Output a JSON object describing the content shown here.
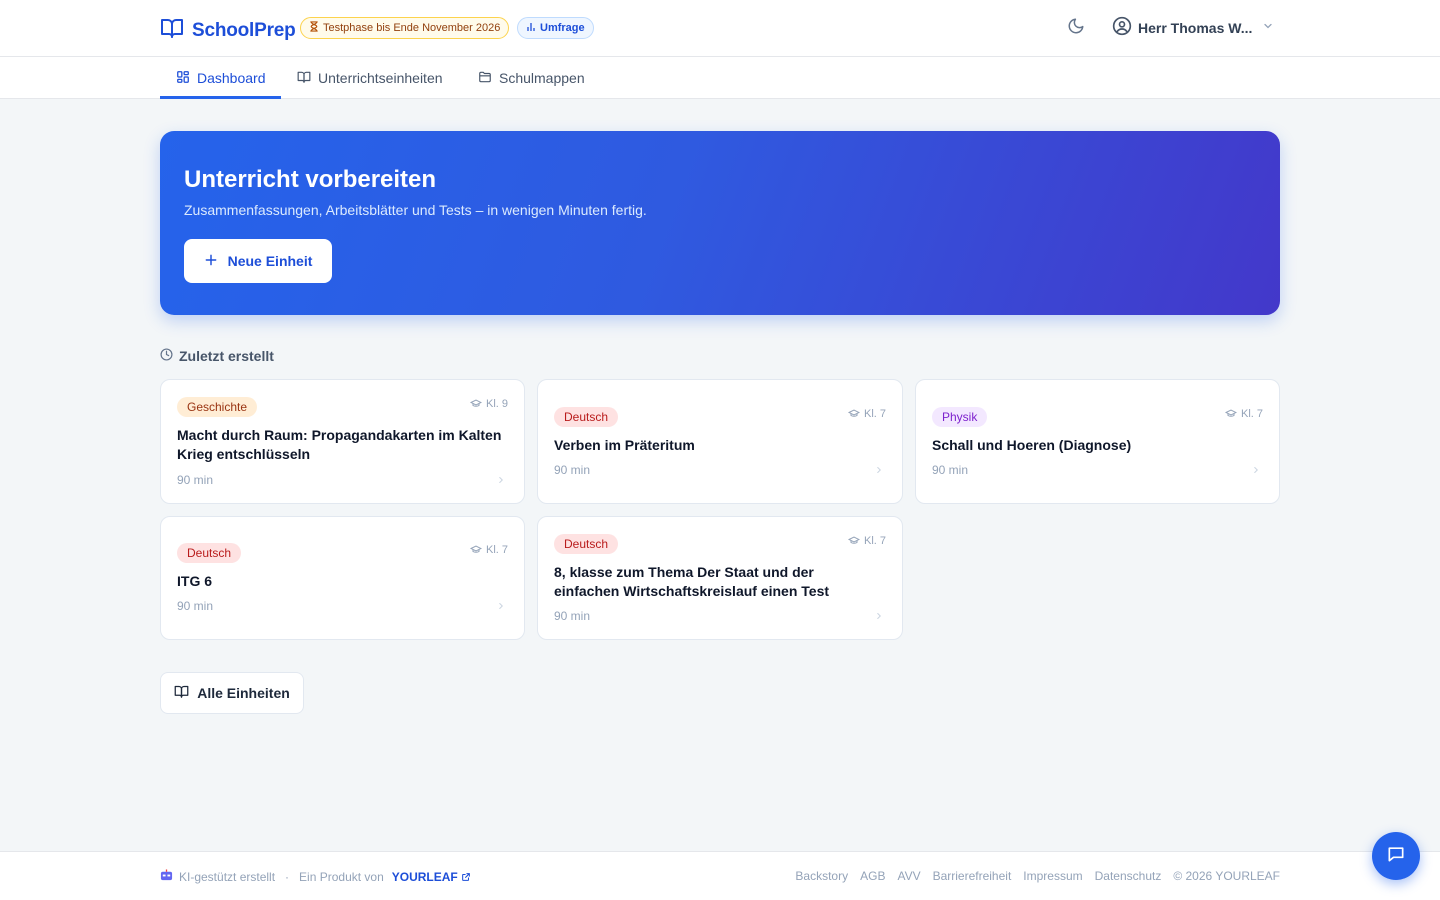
{
  "header": {
    "brand": "SchoolPrep",
    "trial_badge": "Testphase bis Ende November 2026",
    "survey_badge": "Umfrage",
    "user_name": "Herr Thomas W..."
  },
  "nav": {
    "tabs": [
      {
        "label": "Dashboard",
        "icon": "grid-icon",
        "active": true
      },
      {
        "label": "Unterrichtseinheiten",
        "icon": "book-open-icon",
        "active": false
      },
      {
        "label": "Schulmappen",
        "icon": "folder-icon",
        "active": false
      }
    ]
  },
  "hero": {
    "title": "Unterricht vorbereiten",
    "subtitle": "Zusammenfassungen, Arbeitsblätter und Tests – in wenigen Minuten fertig.",
    "button_label": "Neue Einheit"
  },
  "recent": {
    "heading": "Zuletzt erstellt",
    "cards": [
      {
        "subject": "Geschichte",
        "grade": "Kl. 9",
        "title": "Macht durch Raum: Propagandakarten im Kalten Krieg entschlüsseln",
        "duration": "90 min"
      },
      {
        "subject": "Deutsch",
        "grade": "Kl. 7",
        "title": "Verben im Präteritum",
        "duration": "90 min"
      },
      {
        "subject": "Physik",
        "grade": "Kl. 7",
        "title": "Schall und Hoeren (Diagnose)",
        "duration": "90 min"
      },
      {
        "subject": "Deutsch",
        "grade": "Kl. 7",
        "title": "ITG 6",
        "duration": "90 min"
      },
      {
        "subject": "Deutsch",
        "grade": "Kl. 7",
        "title": "8, klasse zum Thema Der Staat und der einfachen Wirtschaftskreislauf einen Test",
        "duration": "90 min"
      }
    ],
    "all_button": "Alle Einheiten"
  },
  "footer": {
    "ai_note": "KI-gestützt erstellt",
    "separator": "·",
    "product_of": "Ein Produkt von",
    "company": "YOURLEAF",
    "links": [
      "Backstory",
      "AGB",
      "AVV",
      "Barrierefreiheit",
      "Impressum",
      "Datenschutz"
    ],
    "copyright": "© 2026 YOURLEAF"
  },
  "colors": {
    "accent": "#2563eb",
    "geschichte": "#ffedd5",
    "deutsch": "#fee2e2",
    "physik": "#f3e8ff"
  }
}
